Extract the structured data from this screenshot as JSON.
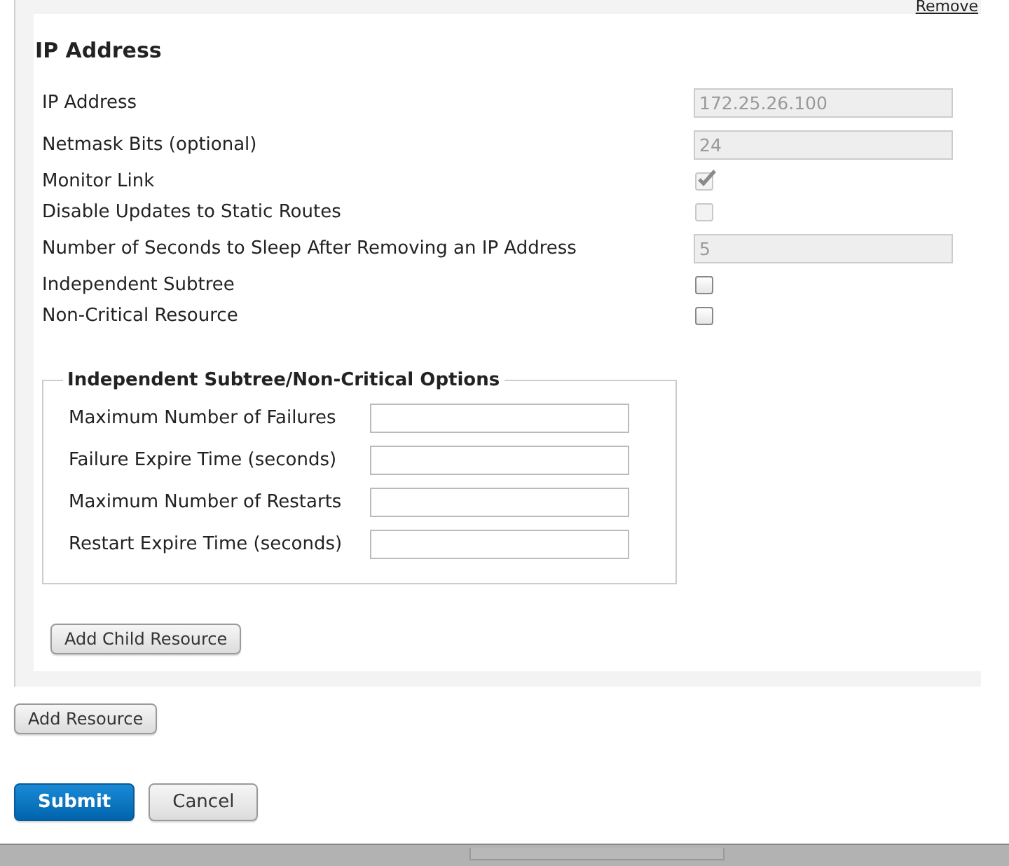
{
  "remove_link": "Remove",
  "section": {
    "title": "IP Address",
    "fields": [
      {
        "kind": "text",
        "label": "IP Address",
        "value": "172.25.26.100",
        "disabled": true
      },
      {
        "kind": "text",
        "label": "Netmask Bits (optional)",
        "value": "24",
        "disabled": true
      },
      {
        "kind": "checkbox",
        "label": "Monitor Link",
        "checked": true,
        "disabled": true
      },
      {
        "kind": "checkbox",
        "label": "Disable Updates to Static Routes",
        "checked": false,
        "disabled": true
      },
      {
        "kind": "text",
        "label": "Number of Seconds to Sleep After Removing an IP Address",
        "value": "5",
        "disabled": true
      },
      {
        "kind": "checkbox",
        "label": "Independent Subtree",
        "checked": false,
        "disabled": false
      },
      {
        "kind": "checkbox",
        "label": "Non-Critical Resource",
        "checked": false,
        "disabled": false
      }
    ],
    "options": {
      "legend": "Independent Subtree/Non-Critical Options",
      "fields": [
        {
          "label": "Maximum Number of Failures"
        },
        {
          "label": "Failure Expire Time (seconds)"
        },
        {
          "label": "Maximum Number of Restarts"
        },
        {
          "label": "Restart Expire Time (seconds)"
        }
      ]
    },
    "add_child_button": "Add Child Resource"
  },
  "add_resource_button": "Add Resource",
  "actions": [
    {
      "kind": "primary",
      "label": "Submit"
    },
    {
      "kind": "secondary",
      "label": "Cancel"
    }
  ]
}
